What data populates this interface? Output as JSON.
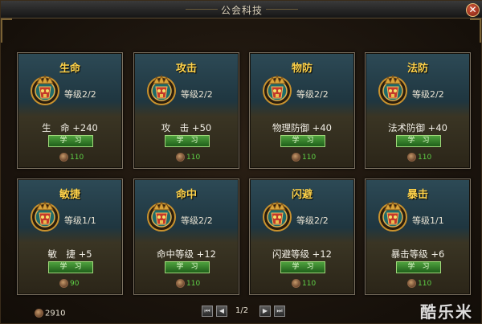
{
  "window": {
    "title": "公会科技",
    "close_icon": "close-icon"
  },
  "cards": [
    {
      "name": "生命",
      "level": "等级2/2",
      "bonus": "生　命 +240",
      "button": "学　习",
      "cost": "110"
    },
    {
      "name": "攻击",
      "level": "等级2/2",
      "bonus": "攻　击 +50",
      "button": "学　习",
      "cost": "110"
    },
    {
      "name": "物防",
      "level": "等级2/2",
      "bonus": "物理防御 +40",
      "button": "学　习",
      "cost": "110"
    },
    {
      "name": "法防",
      "level": "等级2/2",
      "bonus": "法术防御 +40",
      "button": "学　习",
      "cost": "110"
    },
    {
      "name": "敏捷",
      "level": "等级1/1",
      "bonus": "敏　捷 +5",
      "button": "学　习",
      "cost": "90"
    },
    {
      "name": "命中",
      "level": "等级2/2",
      "bonus": "命中等级 +12",
      "button": "学　习",
      "cost": "110"
    },
    {
      "name": "闪避",
      "level": "等级2/2",
      "bonus": "闪避等级 +12",
      "button": "学　习",
      "cost": "110"
    },
    {
      "name": "暴击",
      "level": "等级1/1",
      "bonus": "暴击等级 +6",
      "button": "学　习",
      "cost": "110"
    }
  ],
  "footer": {
    "funds": "2910",
    "page": "1/2"
  },
  "watermark": "酷乐米",
  "colors": {
    "card_title": "#ffd34a",
    "button_green": "#3a8a2e",
    "cost_green": "#5ed046"
  }
}
